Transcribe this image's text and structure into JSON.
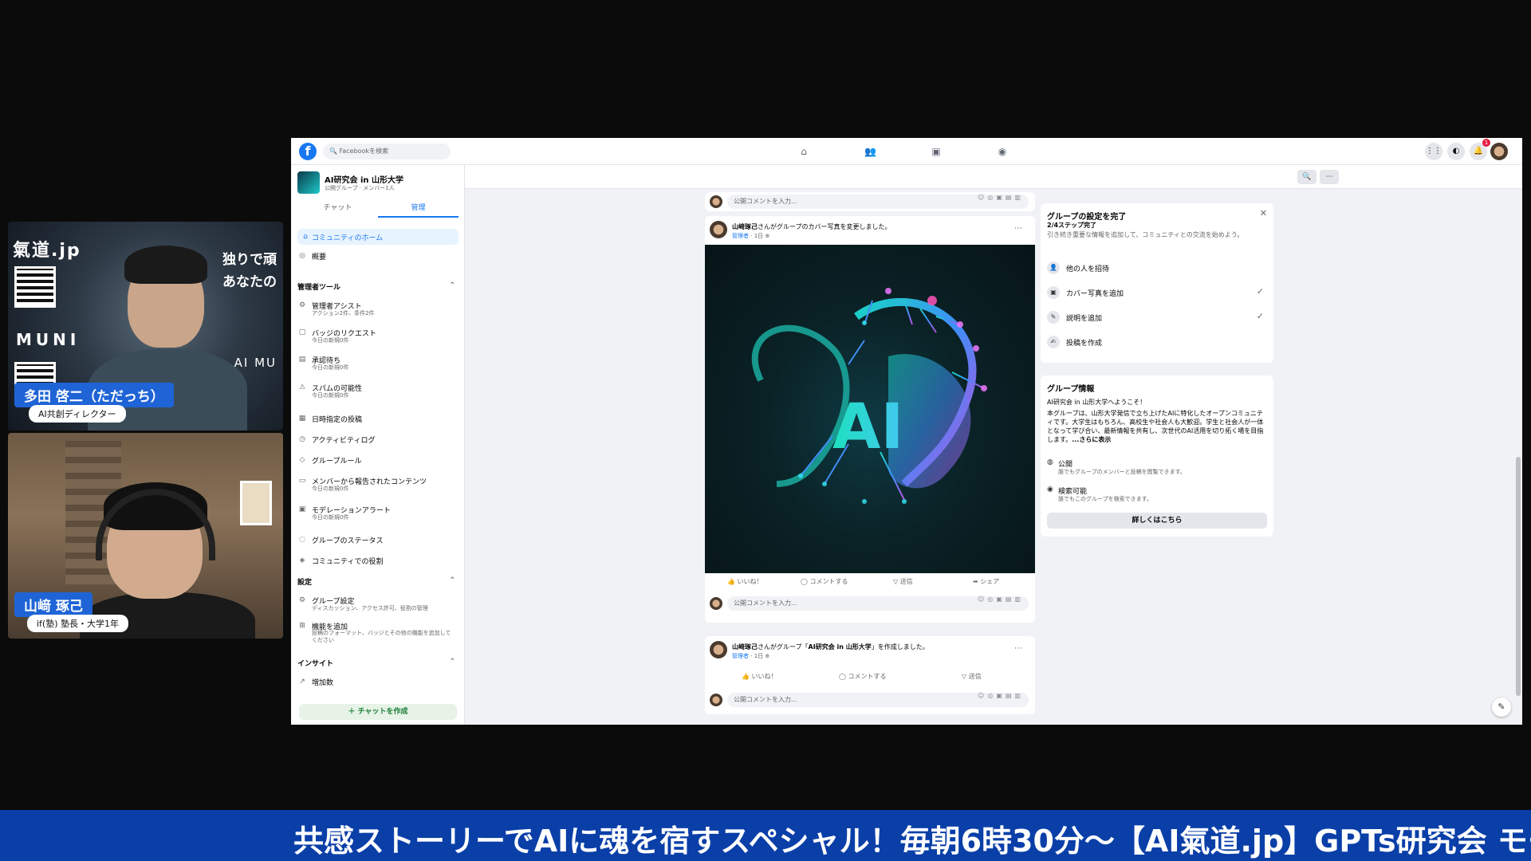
{
  "cam1": {
    "brand": "氣道.jp",
    "muni": "MUNI",
    "tag_line1": "独りで頑",
    "tag_line2": "あなたの",
    "sub": "AI MU",
    "name": "多田 啓二（ただっち）",
    "role": "AI共創ディレクター"
  },
  "cam2": {
    "name": "山﨑 琢己",
    "role": "if(塾) 塾長・大学1年"
  },
  "fb": {
    "logo": "f",
    "search_placeholder": "Facebookを検索",
    "nav_icons": [
      "home-icon",
      "friends-icon",
      "marketplace-icon",
      "groups-icon"
    ],
    "notification_count": "1",
    "group": {
      "name": "AI研究会 in 山形大学",
      "meta": "公開グループ · メンバー1人"
    },
    "tabs": [
      "チャット",
      "管理"
    ],
    "sidebar": {
      "home": "コミュニティのホーム",
      "overview": "概要",
      "admin_tools": "管理者ツール",
      "items": [
        {
          "label": "管理者アシスト",
          "sub": "アクション2件、条件2件"
        },
        {
          "label": "バッジのリクエスト",
          "sub": "今日の新規0件"
        },
        {
          "label": "承認待ち",
          "sub": "今日の新規0件"
        },
        {
          "label": "スパムの可能性",
          "sub": "今日の新規0件"
        },
        {
          "label": "日時指定の投稿",
          "sub": ""
        },
        {
          "label": "アクティビティログ",
          "sub": ""
        },
        {
          "label": "グループルール",
          "sub": ""
        },
        {
          "label": "メンバーから報告されたコンテンツ",
          "sub": "今日の新規0件"
        },
        {
          "label": "モデレーションアラート",
          "sub": "今日の新規0件"
        },
        {
          "label": "グループのステータス",
          "sub": ""
        },
        {
          "label": "コミュニティでの役割",
          "sub": ""
        }
      ],
      "settings": "設定",
      "settings_items": [
        {
          "label": "グループ設定",
          "sub": "ディスカッション、アクセス許可、役割の管理"
        },
        {
          "label": "機能を追加",
          "sub": "投稿のフォーマット、バッジとその他の機能を追加してください"
        }
      ],
      "insights": "インサイト",
      "insights_items": [
        {
          "label": "増加数"
        }
      ],
      "create_chat": "＋ チャットを作成"
    },
    "comment_placeholder": "公開コメントを入力...",
    "post1": {
      "author": "山﨑琢己",
      "action": "さんがグループのカバー写真を変更しました。",
      "role": "管理者",
      "time": "1日",
      "image_text": "AI"
    },
    "post2": {
      "author": "山﨑琢己",
      "action": "さんがグループ「",
      "group": "AI研究会 in 山形大学",
      "action_end": "」を作成しました。",
      "role": "管理者",
      "time": "1日"
    },
    "actions": {
      "like": "いいね！",
      "comment": "コメントする",
      "send": "送信",
      "share": "シェア"
    },
    "setup": {
      "title": "グループの設定を完了",
      "progress": "2/4ステップ完了",
      "desc": "引き続き重要な情報を追加して、コミュニティとの交流を始めよう。",
      "steps": [
        {
          "label": "他の人を招待",
          "done": false
        },
        {
          "label": "カバー写真を追加",
          "done": true
        },
        {
          "label": "説明を追加",
          "done": true
        },
        {
          "label": "投稿を作成",
          "done": false
        }
      ]
    },
    "info": {
      "title": "グループ情報",
      "welcome": "AI研究会 in 山形大学へようこそ！",
      "desc": "本グループは、山形大学発信で立ち上げたAIに特化したオープンコミュニティです。大学生はもちろん、高校生や社会人も大歓迎。学生と社会人が一体となって学び合い、最新情報を共有し、次世代のAI活用を切り拓く場を目指します。",
      "see_more": "...さらに表示",
      "privacy_label": "公開",
      "privacy_desc": "誰でもグループのメンバーと投稿を閲覧できます。",
      "visible_label": "検索可能",
      "visible_desc": "誰でもこのグループを検索できます。",
      "more_button": "詳しくはこちら"
    }
  },
  "ticker": "共感ストーリーでAIに魂を宿すスペシャル！毎朝6時30分〜【AI氣道.jp】GPTs研究会 モー"
}
